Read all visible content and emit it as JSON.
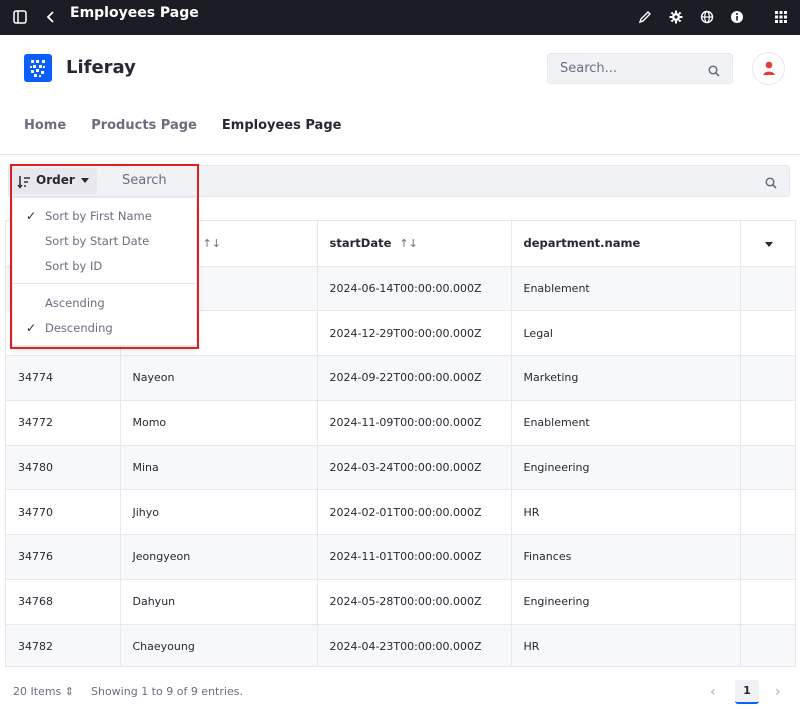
{
  "topbar": {
    "title": "Employees Page",
    "icons": [
      "sidebar-toggle-icon",
      "back-chevron-icon",
      "pencil-icon",
      "gear-icon",
      "globe-icon",
      "info-icon",
      "apps-grid-icon"
    ]
  },
  "header": {
    "brand": "Liferay",
    "search_placeholder": "Search...",
    "nav": [
      "Home",
      "Products Page",
      "Employees Page"
    ],
    "active_nav": "Employees Page"
  },
  "toolbar": {
    "order_label": "Order",
    "search_placeholder": "Search"
  },
  "dropdown": {
    "sort_items": [
      {
        "label": "Sort by First Name",
        "checked": true
      },
      {
        "label": "Sort by Start Date",
        "checked": false
      },
      {
        "label": "Sort by ID",
        "checked": false
      }
    ],
    "direction_items": [
      {
        "label": "Ascending",
        "checked": false
      },
      {
        "label": "Descending",
        "checked": true
      }
    ]
  },
  "table": {
    "columns": [
      "",
      "",
      "startDate",
      "department.name",
      ""
    ],
    "rows": [
      [
        "",
        "",
        "2024-06-14T00:00:00.000Z",
        "Enablement"
      ],
      [
        "",
        "",
        "2024-12-29T00:00:00.000Z",
        "Legal"
      ],
      [
        "34774",
        "Nayeon",
        "2024-09-22T00:00:00.000Z",
        "Marketing"
      ],
      [
        "34772",
        "Momo",
        "2024-11-09T00:00:00.000Z",
        "Enablement"
      ],
      [
        "34780",
        "Mina",
        "2024-03-24T00:00:00.000Z",
        "Engineering"
      ],
      [
        "34770",
        "Jihyo",
        "2024-02-01T00:00:00.000Z",
        "HR"
      ],
      [
        "34776",
        "Jeongyeon",
        "2024-11-01T00:00:00.000Z",
        "Finances"
      ],
      [
        "34768",
        "Dahyun",
        "2024-05-28T00:00:00.000Z",
        "Engineering"
      ],
      [
        "34782",
        "Chaeyoung",
        "2024-04-23T00:00:00.000Z",
        "HR"
      ]
    ]
  },
  "footer": {
    "items_per_page": "20 Items",
    "showing": "Showing 1 to 9 of 9 entries.",
    "current_page": "1"
  },
  "colors": {
    "topbar_bg": "#1c1c24",
    "accent": "#0b5fff",
    "highlight": "#e02020",
    "avatar": "#e53a3a"
  }
}
